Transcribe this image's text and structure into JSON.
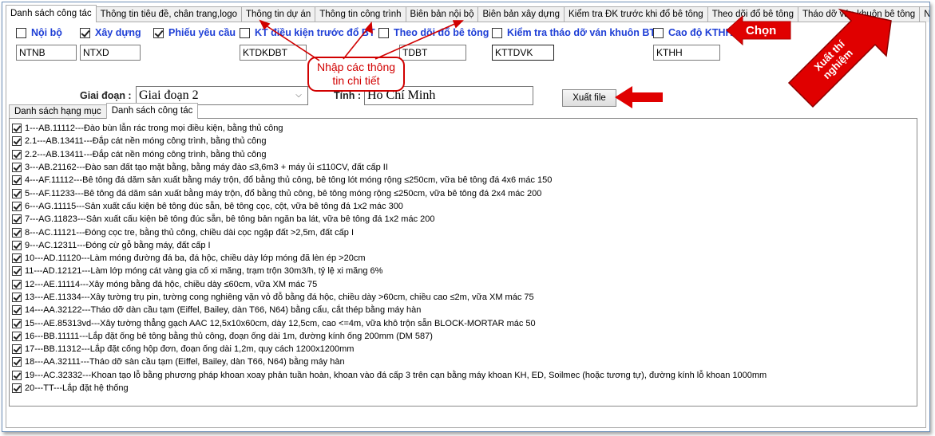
{
  "top_tabs": [
    {
      "label": "Danh sách công tác",
      "active": true
    },
    {
      "label": "Thông tin tiêu đề, chân trang,logo",
      "active": false
    },
    {
      "label": "Thông tin dự án",
      "active": false
    },
    {
      "label": "Thông tin công trình",
      "active": false
    },
    {
      "label": "Biên bản nội bộ",
      "active": false
    },
    {
      "label": "Biên bản xây dựng",
      "active": false
    },
    {
      "label": "Kiểm tra ĐK trước khi đổ bê tông",
      "active": false
    },
    {
      "label": "Theo dõi đổ bê tông",
      "active": false
    },
    {
      "label": "Tháo dỡ ván khuôn bê tông",
      "active": false
    },
    {
      "label": "Nghiệm thu vật liệu",
      "active": false
    }
  ],
  "checkboxes": [
    {
      "label": "Nội bộ",
      "checked": false,
      "code": "NTNB"
    },
    {
      "label": "Xây dựng",
      "checked": true,
      "code": "NTXD"
    },
    {
      "label": "Phiếu yêu cầu",
      "checked": true,
      "code": ""
    },
    {
      "label": "KT điều kiện trước đổ BT",
      "checked": false,
      "code": "KTDKDBT"
    },
    {
      "label": "Theo dõi đổ bê tông",
      "checked": false,
      "code": "TDBT"
    },
    {
      "label": "Kiểm tra tháo dỡ ván khuôn BT",
      "checked": false,
      "code": "KTTDVK"
    },
    {
      "label": "Cao độ KTHH",
      "checked": false,
      "code": "KTHH"
    }
  ],
  "stage": {
    "label": "Giai đoạn :",
    "value": "Giai đoạn 2"
  },
  "province": {
    "label": "Tỉnh :",
    "value": "Hồ Chí Minh"
  },
  "export_button": "Xuất file",
  "inner_tabs": [
    {
      "label": "Danh sách hạng mục",
      "active": false
    },
    {
      "label": "Danh sách công tác",
      "active": true
    }
  ],
  "tasks": [
    "1---AB.11112---Đào bùn lẫn rác trong mọi điều kiện, bằng thủ công",
    "2.1---AB.13411---Đắp cát nền móng công trình, bằng thủ công",
    "2.2---AB.13411---Đắp cát nền móng công trình, bằng thủ công",
    "3---AB.21162---Đào san đất tạo mặt bằng, bằng máy đào ≤3,6m3 + máy ủi ≤110CV, đất cấp II",
    "4---AF.11112---Bê tông đá dăm sản xuất bằng máy trộn, đổ bằng thủ công, bê tông lót móng rộng ≤250cm, vữa bê tông đá 4x6 mác 150",
    "5---AF.11233---Bê tông đá dăm sản xuất bằng máy trộn, đổ bằng thủ công, bê tông móng rộng ≤250cm, vữa bê tông đá 2x4 mác 200",
    "6---AG.11115---Sản xuất cấu kiện bê tông đúc sẵn, bê tông cọc, cột, vữa bê tông đá 1x2 mác 300",
    "7---AG.11823---Sản xuất cấu kiện bê tông đúc sẵn, bê tông bản ngăn ba lát, vữa bê tông đá 1x2 mác 200",
    "8---AC.11121---Đóng cọc tre, bằng thủ công, chiều dài cọc ngập đất >2,5m, đất cấp I",
    "9---AC.12311---Đóng cừ gỗ bằng máy, đất cấp I",
    "10---AD.11120---Làm móng đường đá ba, đá hộc, chiều dày lớp móng đã lèn ép >20cm",
    "11---AD.12121---Làm lớp móng cát vàng gia cố xi măng, trạm trộn 30m3/h, tỷ lệ xi măng 6%",
    "12---AE.11114---Xây móng bằng đá hộc, chiều dày ≤60cm, vữa XM mác 75",
    "13---AE.11334---Xây tường trụ pin, tường cong nghiêng vặn vỏ đỗ bằng đá hộc, chiều dày >60cm, chiều cao ≤2m, vữa XM mác 75",
    "14---AA.32122---Tháo dỡ dàn cầu tạm (Eiffel, Bailey, dàn T66, N64) bằng cẩu, cắt thép bằng máy hàn",
    "15---AE.85313vd---Xây tường thẳng gạch AAC 12,5x10x60cm, dày 12,5cm, cao <=4m, vữa khô trộn sẵn BLOCK-MORTAR mác 50",
    "16---BB.11111---Lắp đặt ống bê tông bằng thủ công, đoạn ống dài 1m, đường kính ống 200mm (DM 587)",
    "17---BB.11312---Lắp đặt cống hộp đơn, đoạn ống dài 1,2m, quy cách 1200x1200mm",
    "18---AA.32111---Tháo dỡ sàn cầu tạm (Eiffel, Bailey, dàn T66, N64) bằng máy hàn",
    "19---AC.32332---Khoan tạo lỗ bằng phương pháp khoan xoay phản tuần hoàn, khoan vào đá cấp 3 trên cạn bằng máy khoan KH, ED, Soilmec (hoặc tương tự), đường kính lỗ khoan 1000mm",
    "20---TT---Lắp đặt hệ thống"
  ],
  "annotations": {
    "callout": "Nhập các thông tin chi tiết",
    "choose": "Chọn",
    "export_note": "Xuất thí nghiệm"
  },
  "colors": {
    "label_blue": "#1f3fd6",
    "annotation_red": "#e00000"
  }
}
